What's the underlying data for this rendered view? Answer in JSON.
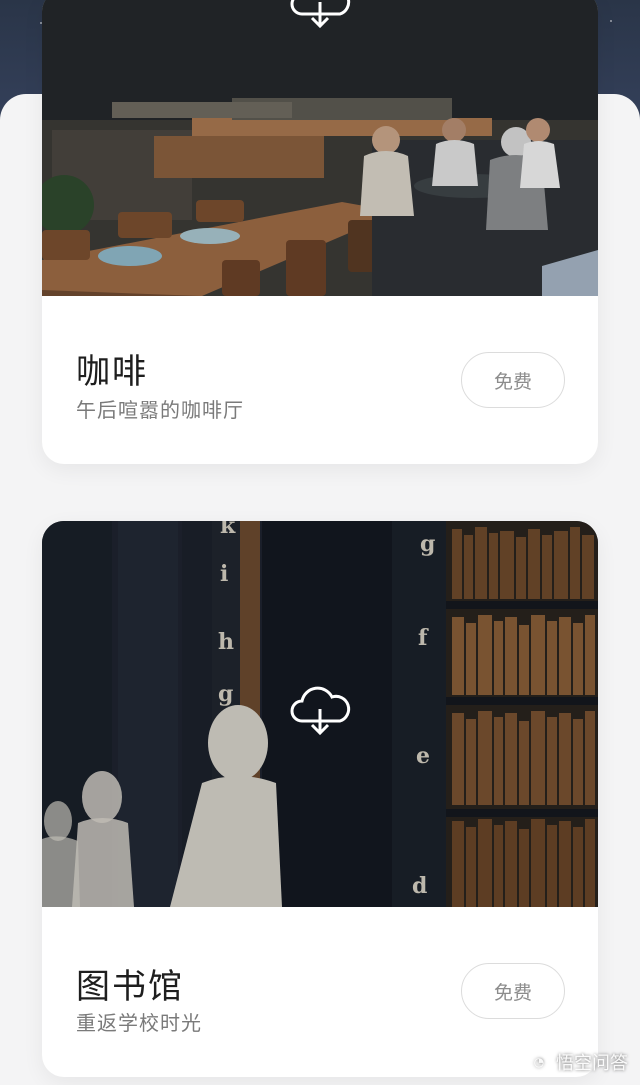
{
  "cards": [
    {
      "title": "咖啡",
      "subtitle": "午后喧嚣的咖啡厅",
      "button_label": "免费",
      "image_description": "cafe interior with people at tables"
    },
    {
      "title": "图书馆",
      "subtitle": "重返学校时光",
      "button_label": "免费",
      "image_description": "library with marble busts and bookshelves",
      "spine_letters": [
        "k",
        "i",
        "h",
        "g",
        "g",
        "f",
        "e",
        "d"
      ]
    }
  ],
  "watermark": {
    "text": "悟空问答"
  },
  "colors": {
    "sky": "#2a3548",
    "card_bg": "#ffffff",
    "page_bg": "#f4f4f5",
    "button_border": "#dcdcdc",
    "button_text": "#8c8c8c"
  }
}
